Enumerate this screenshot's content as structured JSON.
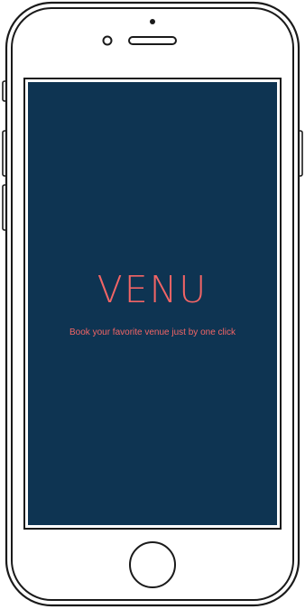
{
  "app": {
    "logo_text": "VENU",
    "tagline": "Book your favorite venue just by one click"
  },
  "colors": {
    "screen_background": "#0e3452",
    "accent": "#f26566",
    "device_outline": "#1a1a1a"
  },
  "icons": {
    "camera": "front-camera-icon",
    "speaker": "speaker-grille-icon",
    "home": "home-button-icon"
  }
}
